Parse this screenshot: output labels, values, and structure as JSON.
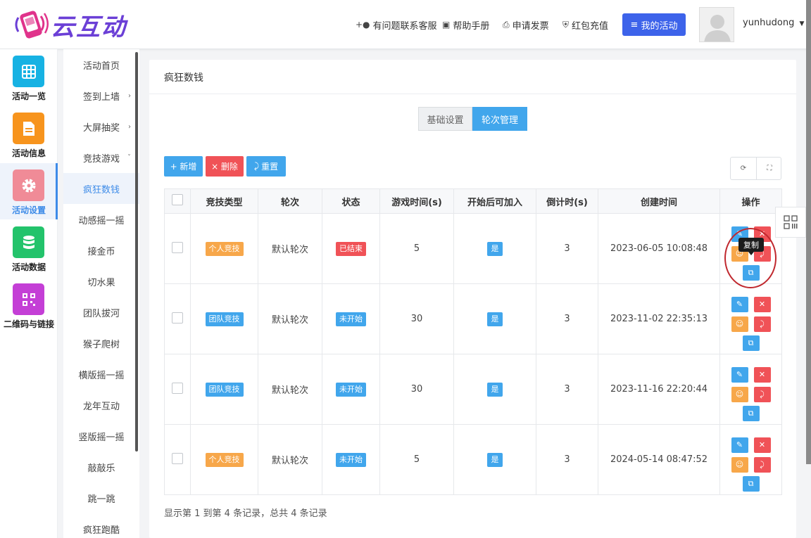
{
  "brand": {
    "name": "云互动"
  },
  "header": {
    "nav": [
      {
        "label": "有问题联系客服",
        "icon": "user-plus-icon"
      },
      {
        "label": "帮助手册",
        "icon": "book-icon"
      },
      {
        "label": "申请发票",
        "icon": "printer-icon"
      },
      {
        "label": "红包充值",
        "icon": "shield-icon"
      }
    ],
    "my_activity": "我的活动",
    "username": "yunhudong"
  },
  "iconbar": [
    {
      "label": "活动一览",
      "icon": "grid-icon",
      "color": "#17b2e3"
    },
    {
      "label": "活动信息",
      "icon": "document-icon",
      "color": "#f7941d"
    },
    {
      "label": "活动设置",
      "icon": "gear-icon",
      "color": "#f08b97"
    },
    {
      "label": "活动数据",
      "icon": "database-icon",
      "color": "#23c36b"
    },
    {
      "label": "二维码与链接",
      "icon": "qrcode-icon",
      "color": "#c43fd6"
    }
  ],
  "subnav": [
    {
      "label": "活动首页",
      "chevron": ""
    },
    {
      "label": "签到上墙",
      "chevron": "›"
    },
    {
      "label": "大屏抽奖",
      "chevron": "›"
    },
    {
      "label": "竞技游戏",
      "chevron": "ˇ"
    },
    {
      "label": "疯狂数钱",
      "chevron": ""
    },
    {
      "label": "动感摇一摇",
      "chevron": ""
    },
    {
      "label": "接金币",
      "chevron": ""
    },
    {
      "label": "切水果",
      "chevron": ""
    },
    {
      "label": "团队拔河",
      "chevron": ""
    },
    {
      "label": "猴子爬树",
      "chevron": ""
    },
    {
      "label": "横版摇一摇",
      "chevron": ""
    },
    {
      "label": "龙年互动",
      "chevron": ""
    },
    {
      "label": "竖版摇一摇",
      "chevron": ""
    },
    {
      "label": "敲敲乐",
      "chevron": ""
    },
    {
      "label": "跳一跳",
      "chevron": ""
    },
    {
      "label": "疯狂跑酷",
      "chevron": ""
    }
  ],
  "panel": {
    "title": "疯狂数钱",
    "tabs": [
      "基础设置",
      "轮次管理"
    ],
    "toolbar": {
      "add": "+ 新增",
      "delete": "× 删除",
      "reset": "重置"
    },
    "footer": "显示第 1 到第 4 条记录，总共 4 条记录"
  },
  "table": {
    "headers": [
      "竞技类型",
      "轮次",
      "状态",
      "游戏时间(s)",
      "开始后可加入",
      "倒计时(s)",
      "创建时间",
      "操作"
    ],
    "rows": [
      {
        "type": "个人竞技",
        "type_color": "orange",
        "round": "默认轮次",
        "status": "已结束",
        "status_color": "red",
        "time": "5",
        "join": "是",
        "countdown": "3",
        "created": "2023-06-05 10:08:48"
      },
      {
        "type": "团队竞技",
        "type_color": "blue",
        "round": "默认轮次",
        "status": "未开始",
        "status_color": "blue",
        "time": "30",
        "join": "是",
        "countdown": "3",
        "created": "2023-11-02 22:35:13"
      },
      {
        "type": "团队竞技",
        "type_color": "blue",
        "round": "默认轮次",
        "status": "未开始",
        "status_color": "blue",
        "time": "30",
        "join": "是",
        "countdown": "3",
        "created": "2023-11-16 22:20:44"
      },
      {
        "type": "个人竞技",
        "type_color": "orange",
        "round": "默认轮次",
        "status": "未开始",
        "status_color": "blue",
        "time": "5",
        "join": "是",
        "countdown": "3",
        "created": "2024-05-14 08:47:52"
      }
    ]
  },
  "tooltip": "复制"
}
